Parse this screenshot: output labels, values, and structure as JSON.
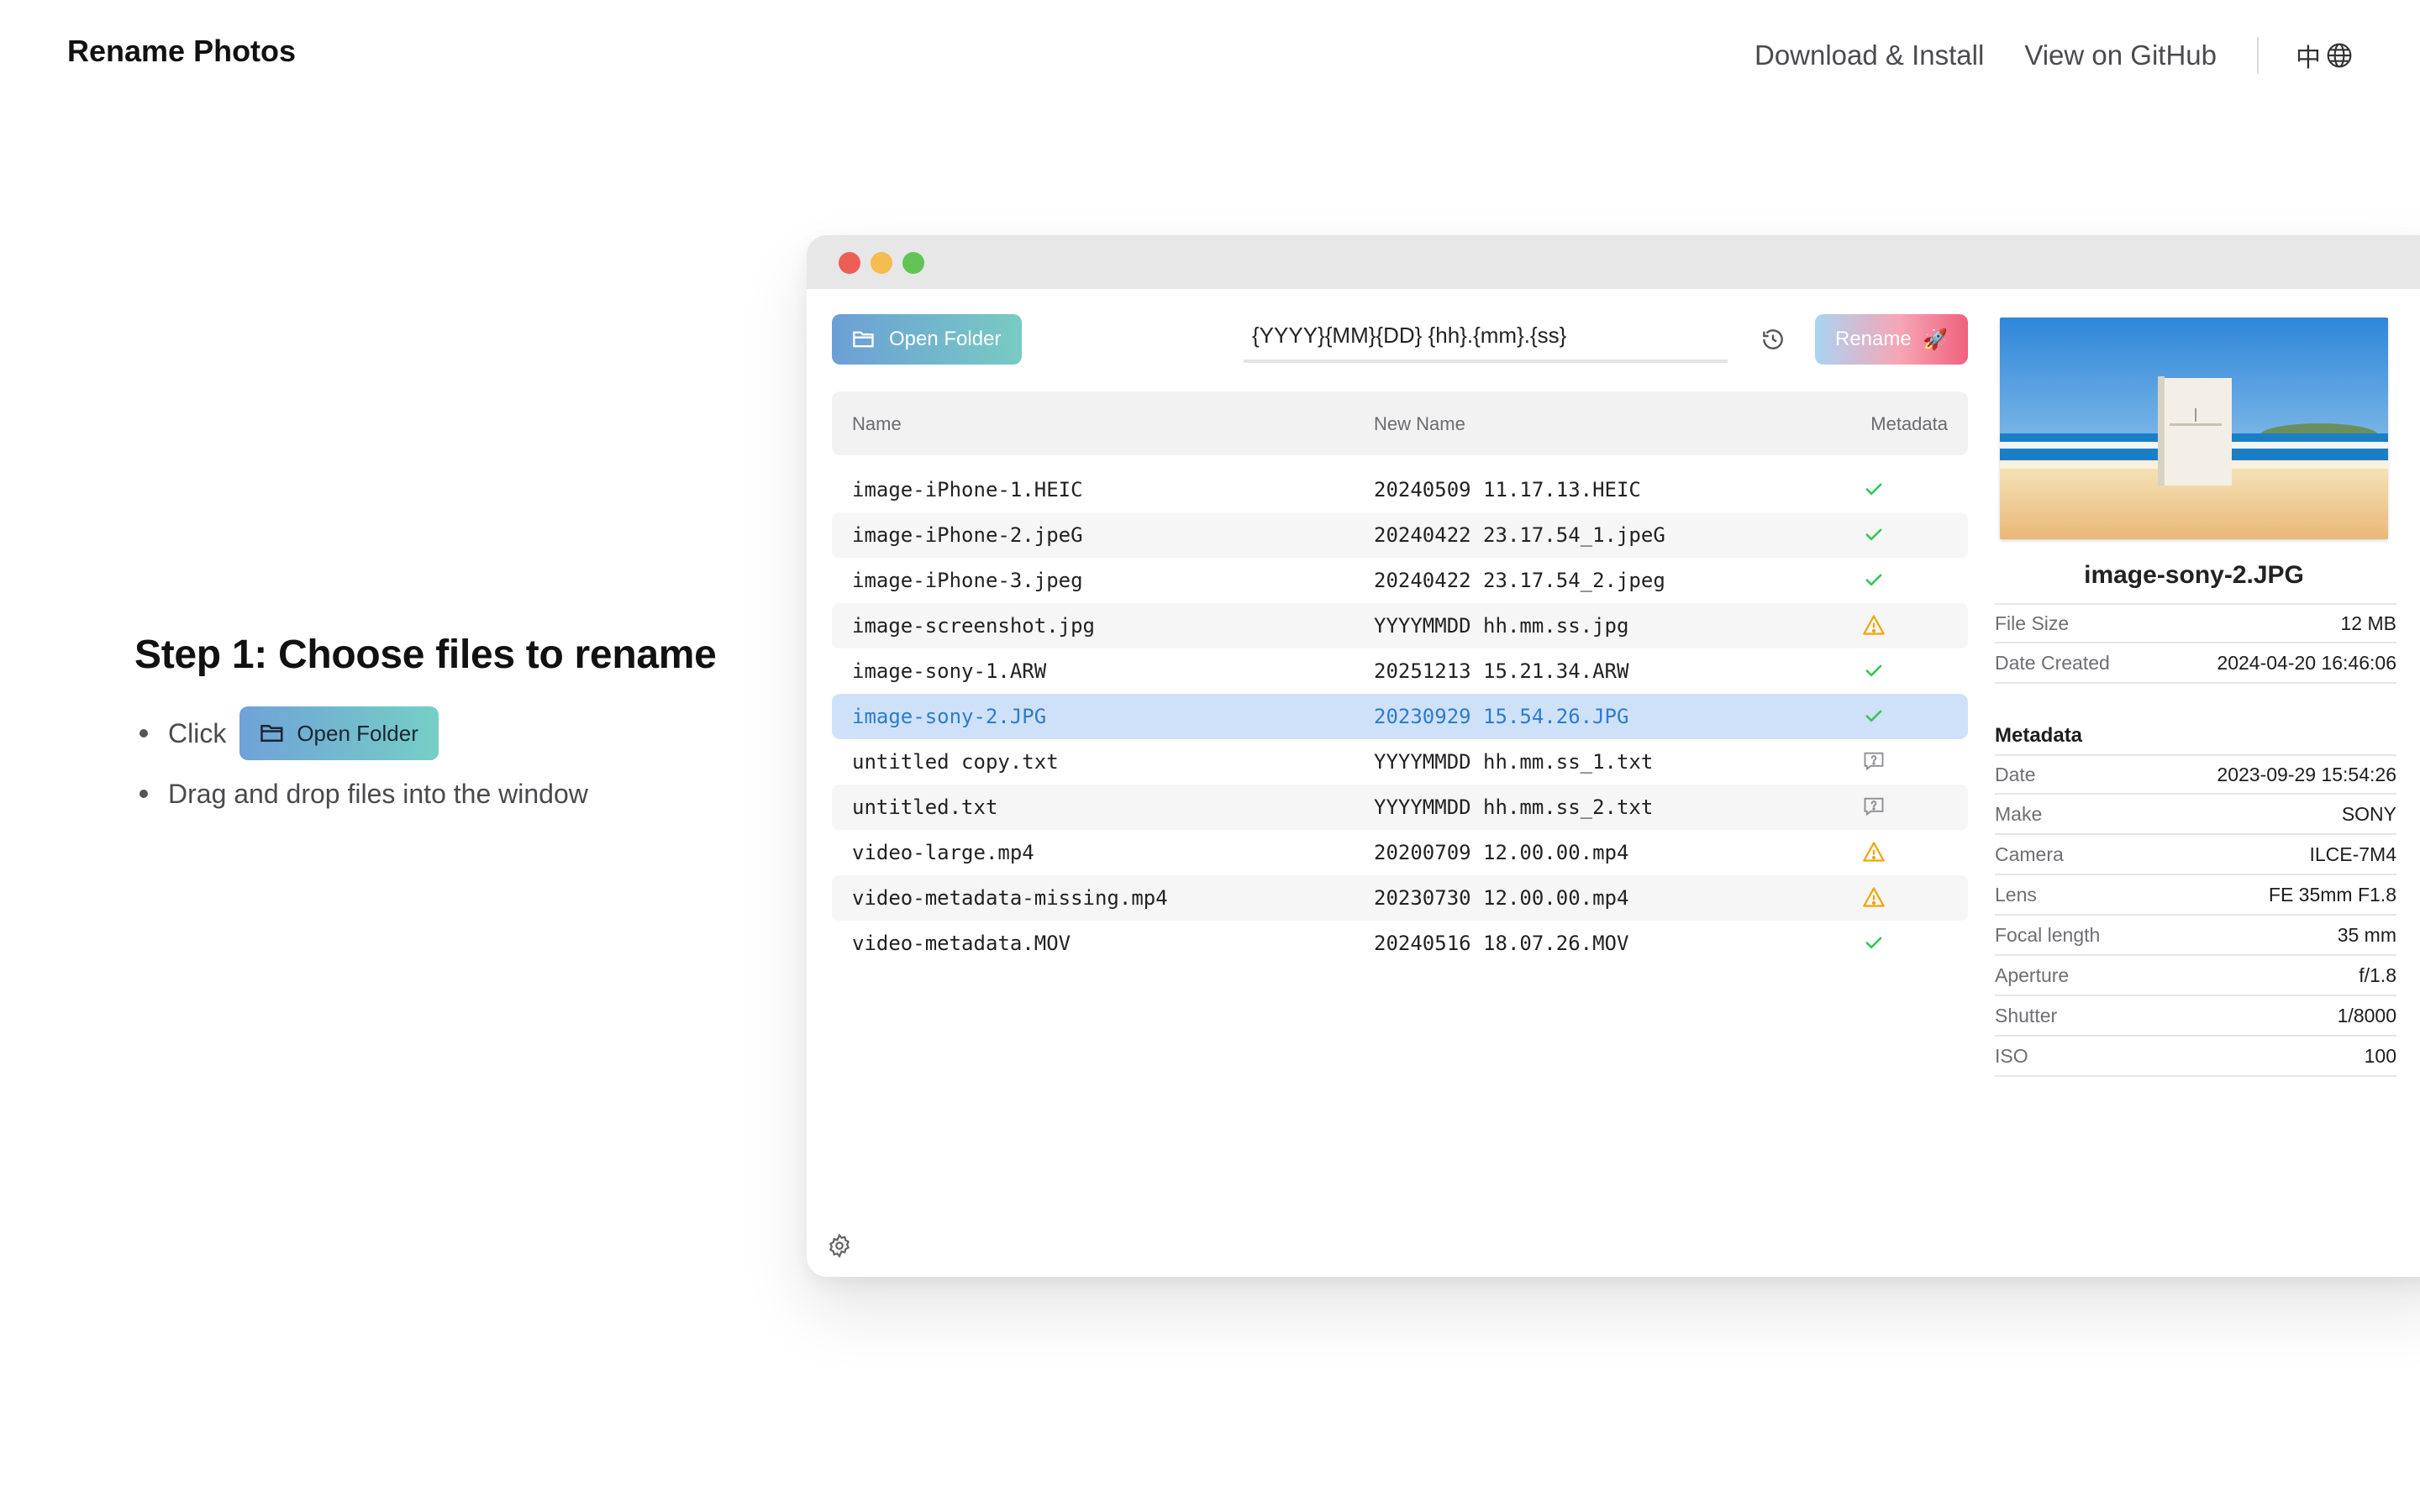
{
  "site": {
    "brand": "Rename Photos",
    "nav": {
      "download": "Download & Install",
      "github": "View on GitHub",
      "lang": "中"
    }
  },
  "intro": {
    "heading": "Step 1: Choose files to rename",
    "click_label": "Click",
    "open_button": "Open Folder",
    "drag_text": "Drag and drop files into the window"
  },
  "app": {
    "toolbar": {
      "open_button": "Open Folder",
      "pattern": "{YYYY}{MM}{DD} {hh}.{mm}.{ss}",
      "rename_button": "Rename",
      "rename_emoji": "🚀"
    },
    "table": {
      "headers": {
        "name": "Name",
        "new_name": "New Name",
        "metadata": "Metadata"
      },
      "rows": [
        {
          "name": "image-iPhone-1.HEIC",
          "new_name": "20240509 11.17.13.HEIC",
          "status": "ok"
        },
        {
          "name": "image-iPhone-2.jpeG",
          "new_name": "20240422 23.17.54_1.jpeG",
          "status": "ok"
        },
        {
          "name": "image-iPhone-3.jpeg",
          "new_name": "20240422 23.17.54_2.jpeg",
          "status": "ok"
        },
        {
          "name": "image-screenshot.jpg",
          "new_name": "YYYYMMDD hh.mm.ss.jpg",
          "status": "warning"
        },
        {
          "name": "image-sony-1.ARW",
          "new_name": "20251213 15.21.34.ARW",
          "status": "ok"
        },
        {
          "name": "image-sony-2.JPG",
          "new_name": "20230929 15.54.26.JPG",
          "status": "ok",
          "selected": true
        },
        {
          "name": "untitled copy.txt",
          "new_name": "YYYYMMDD hh.mm.ss_1.txt",
          "status": "unknown"
        },
        {
          "name": "untitled.txt",
          "new_name": "YYYYMMDD hh.mm.ss_2.txt",
          "status": "unknown"
        },
        {
          "name": "video-large.mp4",
          "new_name": "20200709 12.00.00.mp4",
          "status": "warning"
        },
        {
          "name": "video-metadata-missing.mp4",
          "new_name": "20230730 12.00.00.mp4",
          "status": "warning"
        },
        {
          "name": "video-metadata.MOV",
          "new_name": "20240516 18.07.26.MOV",
          "status": "ok"
        }
      ]
    },
    "preview": {
      "filename": "image-sony-2.JPG",
      "file_info": [
        {
          "key": "File Size",
          "value": "12 MB"
        },
        {
          "key": "Date Created",
          "value": "2024-04-20 16:46:06"
        }
      ],
      "metadata_title": "Metadata",
      "metadata": [
        {
          "key": "Date",
          "value": "2023-09-29 15:54:26"
        },
        {
          "key": "Make",
          "value": "SONY"
        },
        {
          "key": "Camera",
          "value": "ILCE-7M4"
        },
        {
          "key": "Lens",
          "value": "FE 35mm F1.8"
        },
        {
          "key": "Focal length",
          "value": "35 mm"
        },
        {
          "key": "Aperture",
          "value": "f/1.8"
        },
        {
          "key": "Shutter",
          "value": "1/8000"
        },
        {
          "key": "ISO",
          "value": "100"
        }
      ]
    }
  },
  "icons": {
    "ok": "checkmark-icon",
    "warning": "warning-triangle-icon",
    "unknown": "question-bubble-icon"
  },
  "colors": {
    "ok": "#34c759",
    "warning": "#f0a30a",
    "unknown": "#8e8e93",
    "selected_row": "#cfe1f8",
    "selected_text": "#2b7ccf"
  }
}
